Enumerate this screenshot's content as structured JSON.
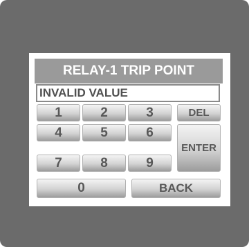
{
  "dialog": {
    "title": "RELAY-1 TRIP POINT",
    "value_display": "INVALID VALUE"
  },
  "keypad": {
    "digits": [
      "1",
      "2",
      "3",
      "4",
      "5",
      "6",
      "7",
      "8",
      "9",
      "0"
    ],
    "del_label": "DEL",
    "enter_label": "ENTER",
    "back_label": "BACK"
  },
  "colors": {
    "bezel": "#6b6b6b",
    "title_bar": "#9a9a9a",
    "key_text": "#585858"
  }
}
